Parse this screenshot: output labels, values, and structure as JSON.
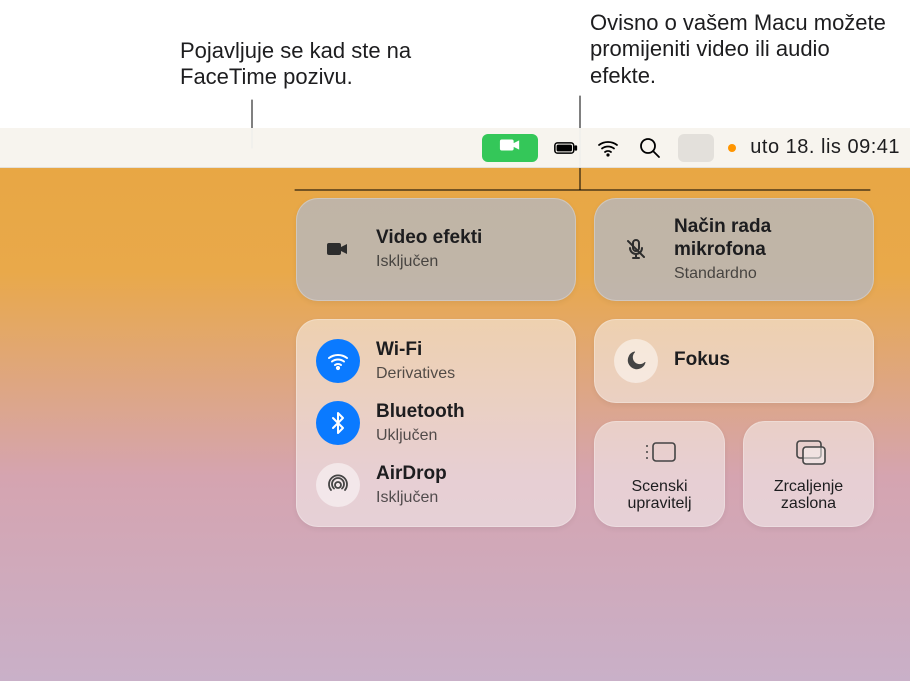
{
  "callouts": {
    "left": "Pojavljuje se kad ste na FaceTime pozivu.",
    "right": "Ovisno o vašem Macu možete promijeniti video ili audio efekte."
  },
  "menubar": {
    "clock": "uto 18. lis  09:41"
  },
  "control_center": {
    "video_effects": {
      "title": "Video efekti",
      "sub": "Isključen"
    },
    "mic_mode": {
      "title": "Način rada mikrofona",
      "sub": "Standardno"
    },
    "wifi": {
      "title": "Wi-Fi",
      "sub": "Derivatives"
    },
    "bluetooth": {
      "title": "Bluetooth",
      "sub": "Uključen"
    },
    "airdrop": {
      "title": "AirDrop",
      "sub": "Isključen"
    },
    "focus": {
      "title": "Fokus"
    },
    "stage_manager": {
      "label": "Scenski upravitelj"
    },
    "screen_mirroring": {
      "label": "Zrcaljenje zaslona"
    }
  }
}
